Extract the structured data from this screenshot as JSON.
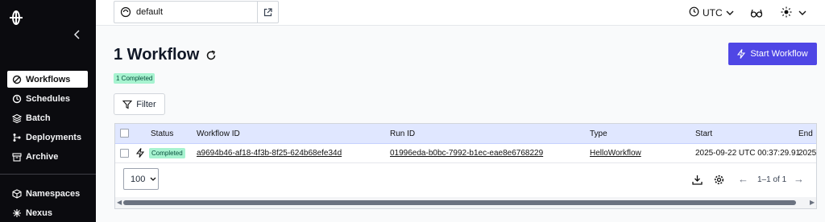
{
  "sidebar": {
    "collapse_icon": "chevron-left-icon",
    "items": [
      {
        "label": "Workflows",
        "icon": "workflows-icon",
        "active": true
      },
      {
        "label": "Schedules",
        "icon": "schedules-icon"
      },
      {
        "label": "Batch",
        "icon": "batch-icon"
      },
      {
        "label": "Deployments",
        "icon": "deployments-icon"
      },
      {
        "label": "Archive",
        "icon": "archive-icon"
      }
    ],
    "bottom_items": [
      {
        "label": "Namespaces",
        "icon": "namespaces-icon"
      },
      {
        "label": "Nexus",
        "icon": "nexus-icon"
      }
    ]
  },
  "topbar": {
    "namespace": "default",
    "timezone": "UTC"
  },
  "main": {
    "title": "1 Workflow",
    "completed_badge": "1 Completed",
    "start_button": "Start Workflow",
    "filter_button": "Filter"
  },
  "table": {
    "columns": [
      "Status",
      "Workflow ID",
      "Run ID",
      "Type",
      "Start",
      "End"
    ],
    "rows": [
      {
        "status": "Completed",
        "workflow_id": "a9694b46-af18-4f3b-8f25-624b68efe34d",
        "run_id": "01996eda-b0bc-7992-b1ec-eae8e6768229",
        "type": "HelloWorkflow",
        "start": "2025-09-22 UTC 00:37:29.91",
        "end": "2025-"
      }
    ],
    "per_page": "100",
    "page_info": "1–1 of 1"
  },
  "colors": {
    "accent": "#4f46e5",
    "completed_bg": "#a7f3d0",
    "header_bg": "#e0e7ff",
    "sidebar_bg": "#0b0b0f"
  }
}
